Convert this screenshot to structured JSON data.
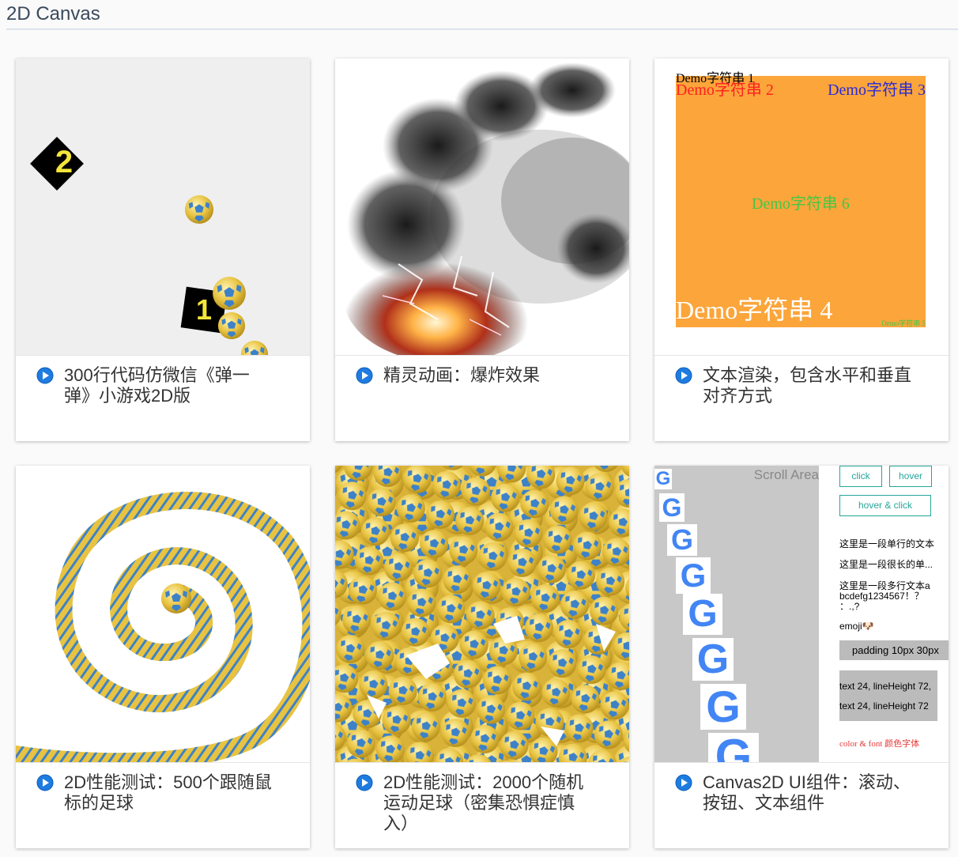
{
  "section": {
    "title": "2D Canvas"
  },
  "cards": [
    {
      "caption": "300行代码仿微信《弹一弹》小游戏2D版",
      "num_a": "2",
      "num_b": "1"
    },
    {
      "caption": "精灵动画：爆炸效果"
    },
    {
      "caption": "文本渲染，包含水平和垂直对齐方式",
      "demo_texts": [
        "Demo字符串 1",
        "Demo字符串 2",
        "Demo字符串 3",
        "Demo字符串 6",
        "Demo字符串 4",
        "Demo字符串 5"
      ],
      "colors": {
        "box": "#fba53b",
        "red": "#ff2020",
        "blue": "#2a2ad6",
        "green": "#44c744",
        "white": "#ffffff"
      }
    },
    {
      "caption": "2D性能测试：500个跟随鼠标的足球"
    },
    {
      "caption": "2D性能测试：2000个随机运动足球（密集恐惧症慎入）"
    },
    {
      "caption": "Canvas2D UI组件：滚动、按钮、文本组件",
      "ui": {
        "scroll_label": "Scroll Area",
        "g_letter": "G",
        "btn_click": "click",
        "btn_hover": "hover",
        "btn_hover_click": "hover & click",
        "single_line": "这里是一段单行的文本",
        "long_line": "这里是一段很长的单...",
        "multi_line_1": "这里是一段多行文本a",
        "multi_line_2": "bcdefg1234567！？",
        "multi_line_3": "：.,?",
        "emoji": "emoji🐶",
        "padding": "padding 10px 30px",
        "lh_1": "text 24, lineHeight 72,",
        "lh_2": "text 24, lineHeight 72",
        "color_font": "color & font 颜色字体"
      }
    }
  ],
  "icons": {
    "play": "play-circle-icon"
  },
  "colors": {
    "play_blue": "#1e7be0",
    "accent": "#26a69a",
    "ball_yellow": "#e8c341",
    "ball_blue": "#3d82c8"
  }
}
